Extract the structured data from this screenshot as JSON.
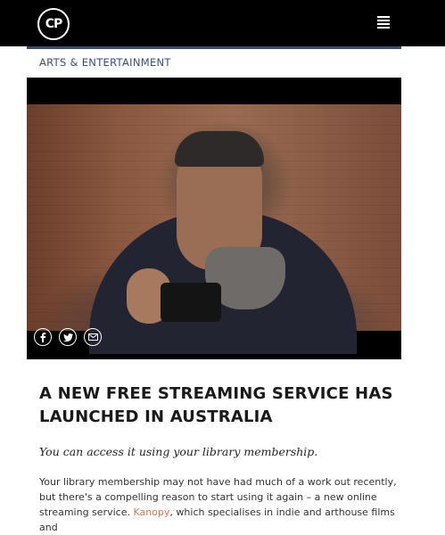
{
  "header": {
    "logo_text": "CP",
    "menu_icon": "hamburger-menu-icon"
  },
  "category": "ARTS & ENTERTAINMENT",
  "share": {
    "facebook_icon": "facebook-icon",
    "twitter_icon": "twitter-icon",
    "email_icon": "email-icon"
  },
  "article": {
    "headline": "A NEW FREE STREAMING SERVICE HAS LAUNCHED IN AUSTRALIA",
    "standfirst": "You can access it using your library membership.",
    "body_part1": "Your library membership may not have had much of a work out recently, but there's a compelling reason to start using it again – a new online streaming service. ",
    "body_link": "Kanopy",
    "body_part2": ", which specialises in indie and arthouse films and"
  },
  "colors": {
    "topbar": "#000000",
    "accent_rule": "#3a4a6b",
    "category_text": "#3a4f78",
    "link": "#c77a55"
  }
}
